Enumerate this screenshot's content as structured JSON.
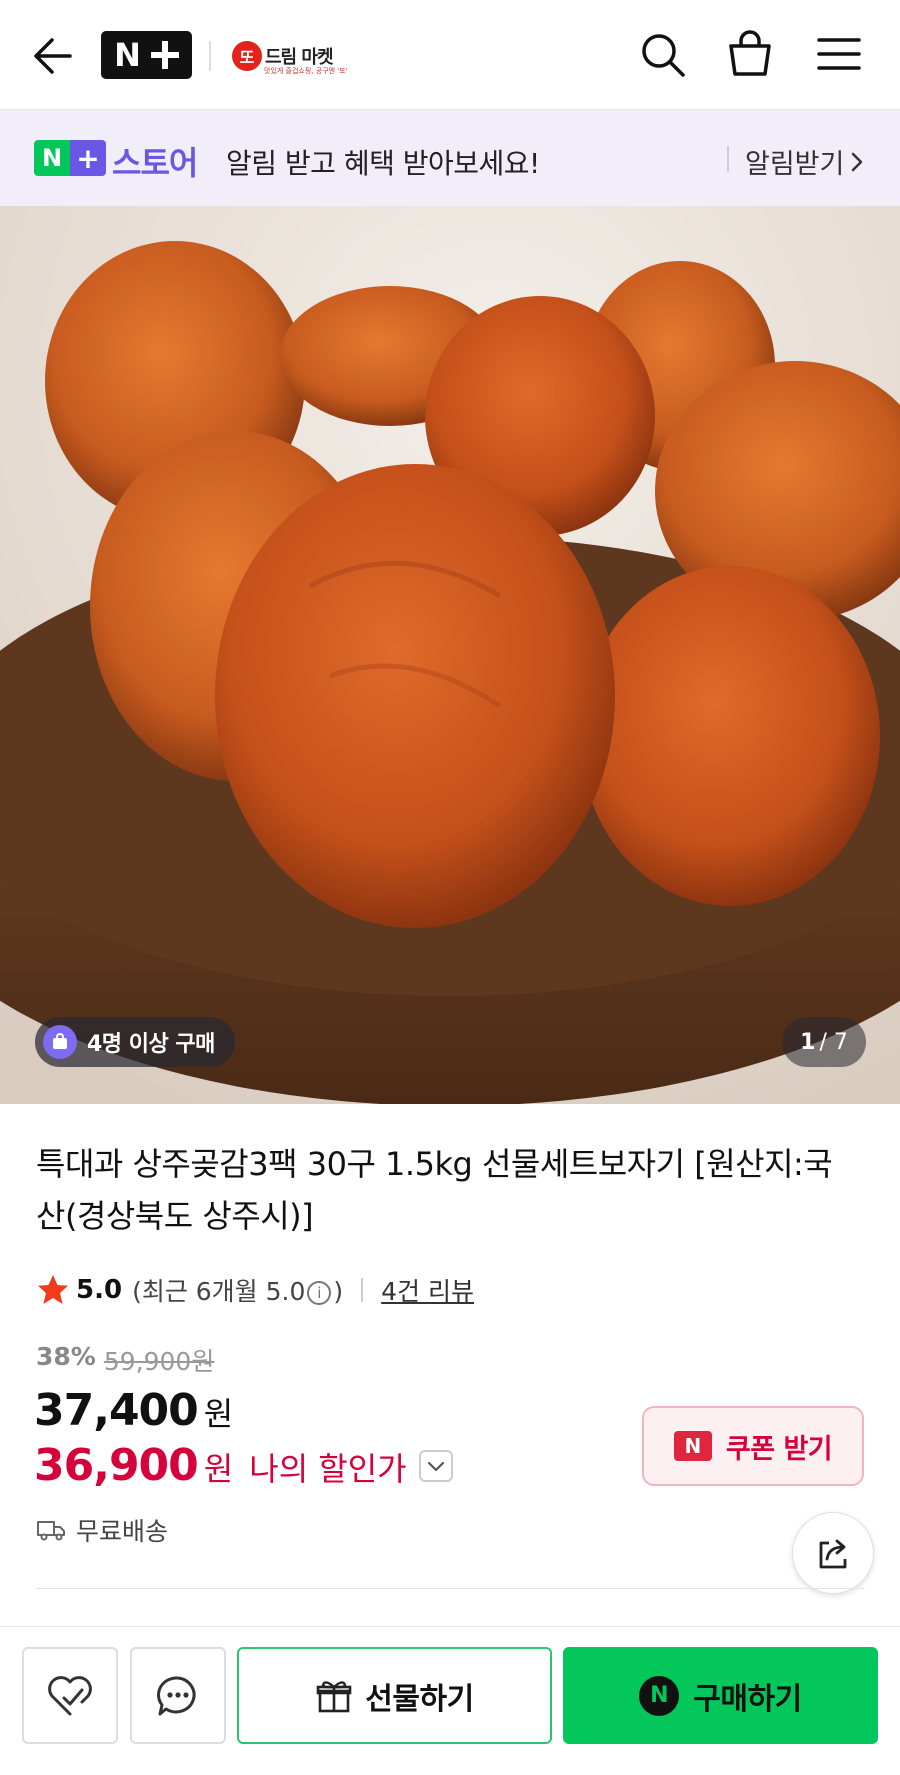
{
  "header": {
    "store_badge": "또",
    "store_name": "드림 마켓",
    "store_tagline": "맛있게 즐겁쇼핑, 공구엔 '또'"
  },
  "banner": {
    "brand_n": "N",
    "brand_plus": "+",
    "store_word": "스토어",
    "message": "알림 받고 혜택 받아보세요!",
    "cta_label": "알림받기",
    "accent": "#6b57e6",
    "green": "#03c75a"
  },
  "hero": {
    "buyers_chip": "4명 이상 구매",
    "counter_current": "1",
    "counter_total": "/ 7"
  },
  "product": {
    "title": "특대과 상주곶감3팩 30구 1.5kg 선물세트보자기 [원산지:국산(경상북도 상주시)]",
    "rating_score": "5.0",
    "rating_recent": "(최근 6개월 5.0",
    "rating_recent_end": ")",
    "info_icon": "i",
    "review_link": "4건 리뷰",
    "discount_pct": "38%",
    "original_price": "59,900원",
    "price": "37,400",
    "price_unit": "원",
    "my_price": "36,900",
    "my_price_unit": "원",
    "my_price_label": "나의 할인가",
    "shipping": "무료배송",
    "price_red": "#d6003b"
  },
  "coupon": {
    "icon_letter": "N",
    "label": "쿠폰 받기"
  },
  "bottom_bar": {
    "gift_label": "선물하기",
    "buy_icon_letter": "N",
    "buy_label": "구매하기"
  },
  "icons": [
    "back-icon",
    "search-icon",
    "shopping-bag-icon",
    "menu-icon",
    "chevron-right-icon",
    "bag-badge-icon",
    "star-icon",
    "info-icon",
    "chevron-down-icon",
    "truck-icon",
    "share-icon",
    "heart-check-icon",
    "chat-icon",
    "gift-icon"
  ]
}
